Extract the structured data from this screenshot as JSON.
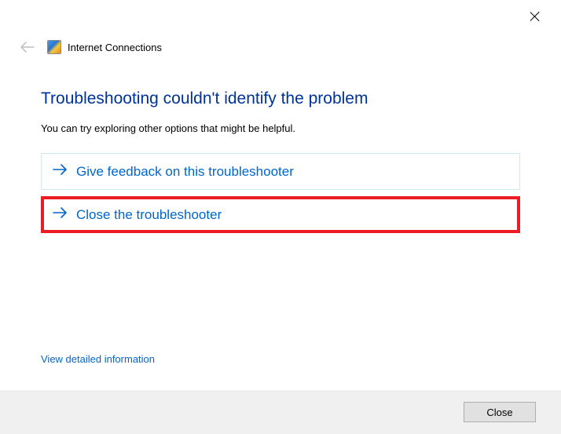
{
  "window": {
    "title": "Internet Connections"
  },
  "main": {
    "heading": "Troubleshooting couldn't identify the problem",
    "subtext": "You can try exploring other options that might be helpful."
  },
  "options": {
    "feedback": "Give feedback on this troubleshooter",
    "close": "Close the troubleshooter"
  },
  "links": {
    "detail": "View detailed information"
  },
  "footer": {
    "close_label": "Close"
  },
  "colors": {
    "link": "#0066cc",
    "heading": "#003399",
    "highlight_border": "#ed1c24"
  }
}
